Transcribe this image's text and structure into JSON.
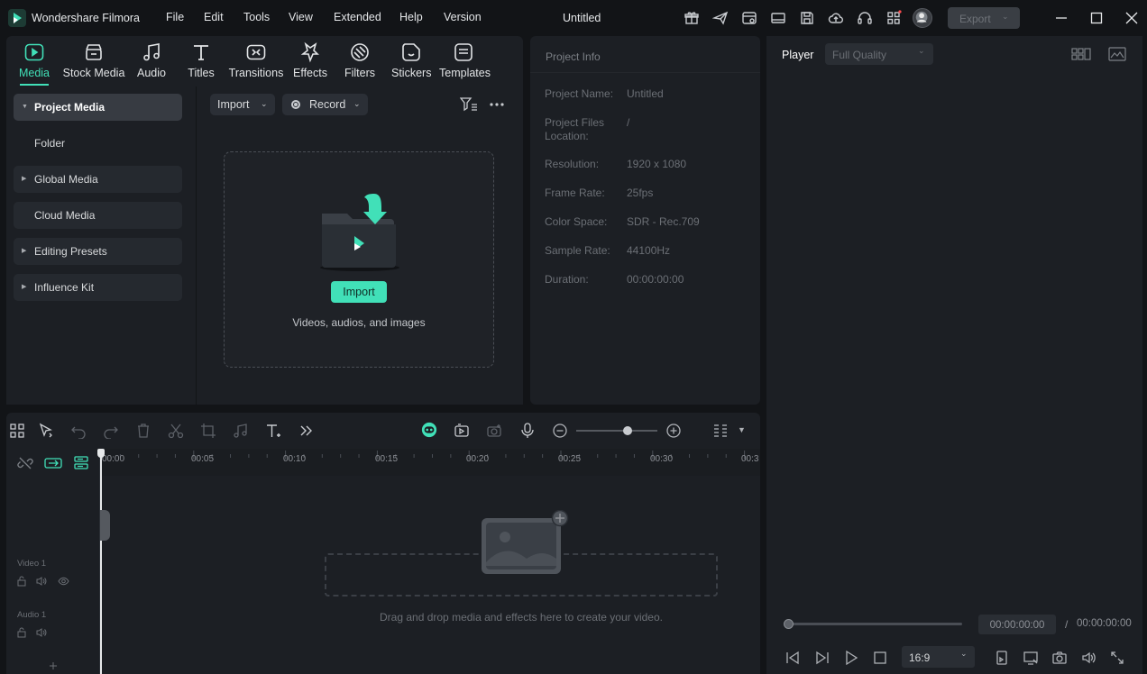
{
  "app": {
    "name": "Wondershare Filmora",
    "project_title": "Untitled"
  },
  "menu": [
    "File",
    "Edit",
    "Tools",
    "View",
    "Extended",
    "Help",
    "Version"
  ],
  "titlebar": {
    "export_label": "Export"
  },
  "toolbar_tabs": [
    {
      "label": "Media",
      "icon": "media-icon"
    },
    {
      "label": "Stock Media",
      "icon": "stock-media-icon"
    },
    {
      "label": "Audio",
      "icon": "music-note-icon"
    },
    {
      "label": "Titles",
      "icon": "text-t-icon"
    },
    {
      "label": "Transitions",
      "icon": "transition-icon"
    },
    {
      "label": "Effects",
      "icon": "effects-icon"
    },
    {
      "label": "Filters",
      "icon": "filter-icon"
    },
    {
      "label": "Stickers",
      "icon": "sticker-icon"
    },
    {
      "label": "Templates",
      "icon": "template-icon"
    }
  ],
  "sidebar": {
    "items": [
      {
        "label": "Project Media"
      },
      {
        "label": "Folder"
      },
      {
        "label": "Global Media"
      },
      {
        "label": "Cloud Media"
      },
      {
        "label": "Editing Presets"
      },
      {
        "label": "Influence Kit"
      }
    ]
  },
  "media": {
    "import_label": "Import",
    "record_label": "Record",
    "import_button": "Import",
    "hint": "Videos, audios, and images"
  },
  "project_info": {
    "title": "Project Info",
    "rows": [
      {
        "label": "Project Name:",
        "value": "Untitled"
      },
      {
        "label": "Project Files Location:",
        "value": "/"
      },
      {
        "label": "Resolution:",
        "value": "1920 x 1080"
      },
      {
        "label": "Frame Rate:",
        "value": "25fps"
      },
      {
        "label": "Color Space:",
        "value": "SDR - Rec.709"
      },
      {
        "label": "Sample Rate:",
        "value": "44100Hz"
      },
      {
        "label": "Duration:",
        "value": "00:00:00:00"
      }
    ]
  },
  "player": {
    "tab_label": "Player",
    "quality": "Full Quality",
    "current_time": "00:00:00:00",
    "separator": "/",
    "total_time": "00:00:00:00",
    "aspect_ratio": "16:9",
    "progress": 0.0
  },
  "timeline": {
    "ruler": [
      "00:00",
      "00:05",
      "00:10",
      "00:15",
      "00:20",
      "00:25",
      "00:30",
      "00:3"
    ],
    "tracks": [
      {
        "label": "Video 1"
      },
      {
        "label": "Audio 1"
      }
    ],
    "drop_hint": "Drag and drop media and effects here to create your video.",
    "zoom_level": 0.75
  },
  "colors": {
    "accent": "#41e0b8",
    "background": "#121417",
    "panel": "#1c1f24"
  }
}
